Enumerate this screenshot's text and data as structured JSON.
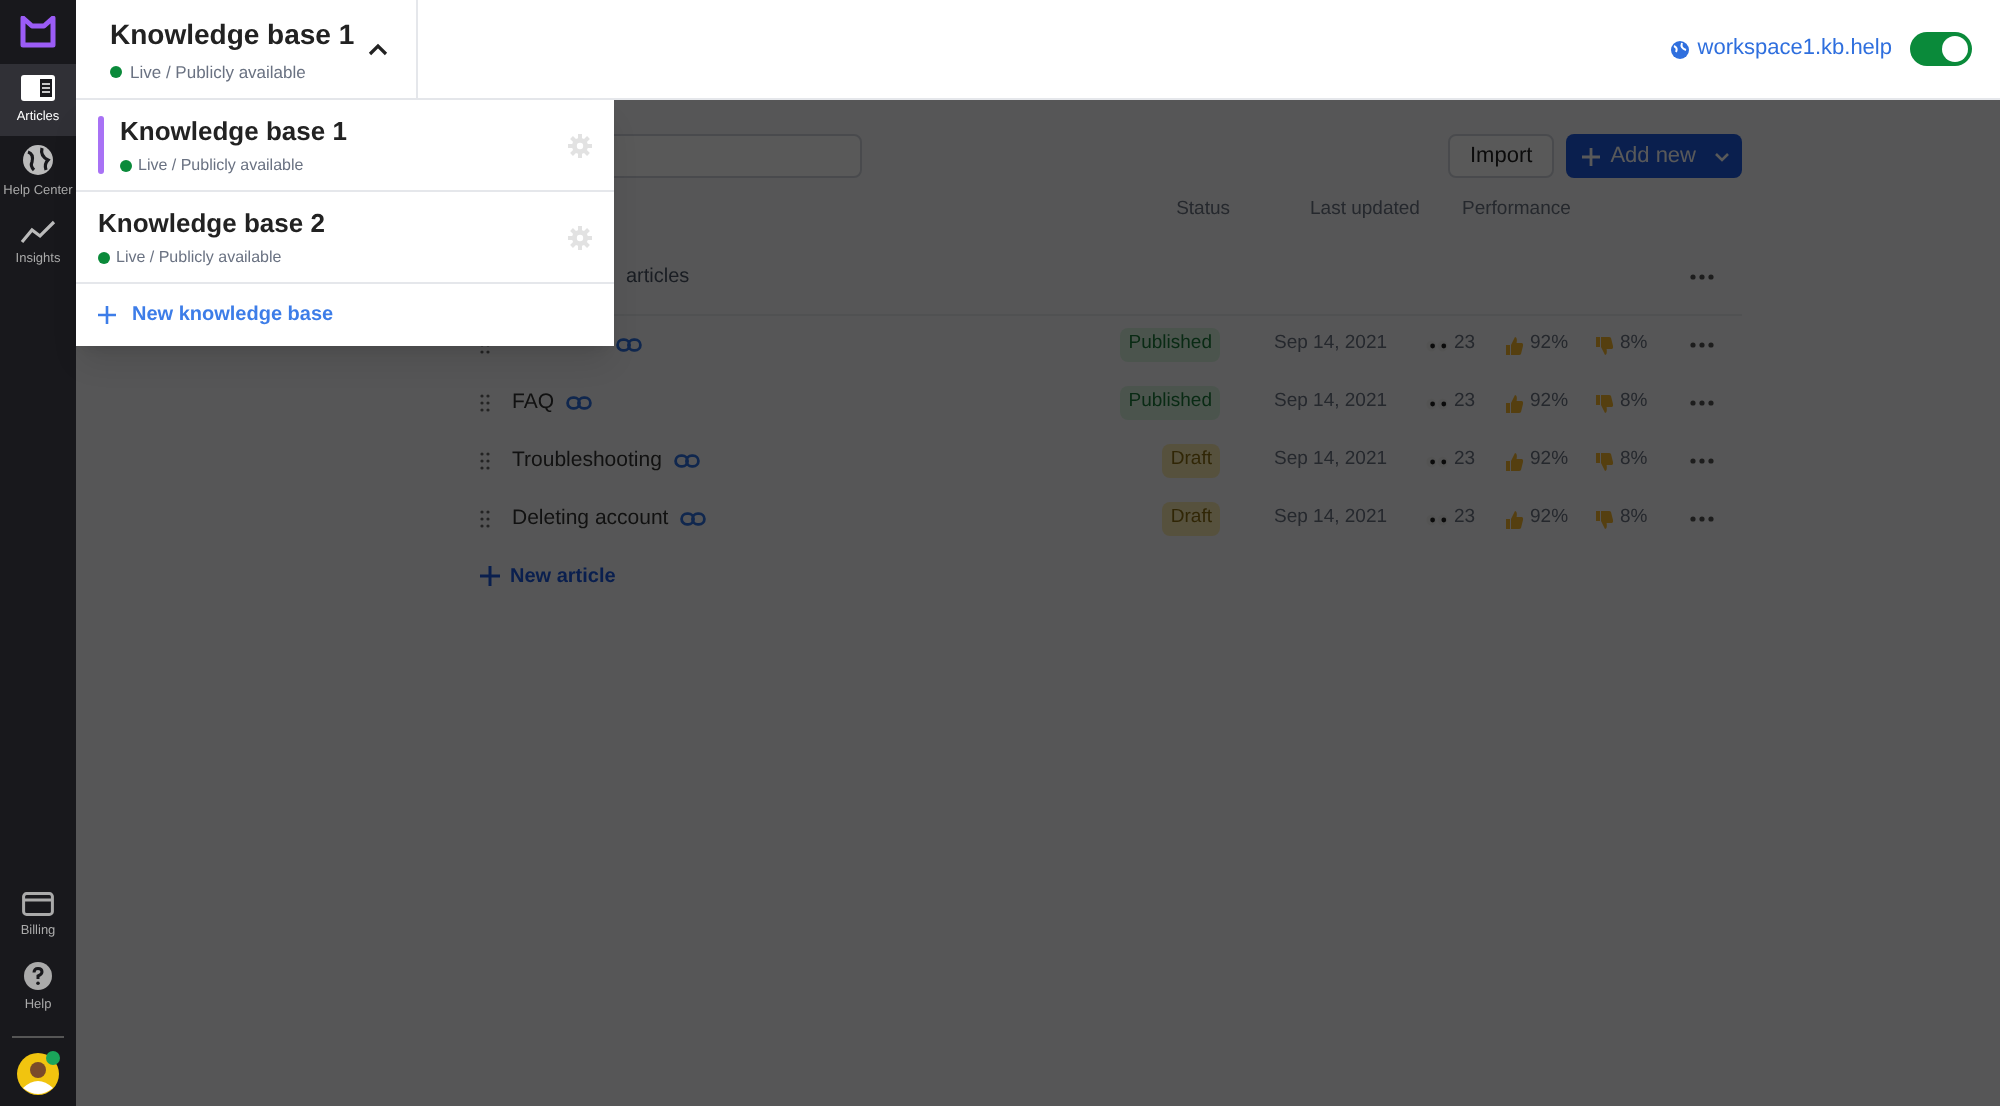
{
  "sidebar": {
    "items": [
      {
        "label": "Articles",
        "selected": true
      },
      {
        "label": "Help Center",
        "selected": false
      },
      {
        "label": "Insights",
        "selected": false
      }
    ],
    "bottom_items": [
      {
        "label": "Billing"
      },
      {
        "label": "Help"
      }
    ]
  },
  "header": {
    "title": "Knowledge base 1",
    "status": "Live / Publicly available",
    "link": "workspace1.kb.help",
    "toggle": {
      "on": true
    }
  },
  "dropdown": {
    "items": [
      {
        "title": "Knowledge base 1",
        "status": "Live / Publicly available",
        "selected": true
      },
      {
        "title": "Knowledge base 2",
        "status": "Live / Publicly available",
        "selected": false
      }
    ],
    "new_button": "New knowledge base"
  },
  "toolbar": {
    "import": "Import",
    "add_new": "Add new"
  },
  "table": {
    "columns": [
      "Status",
      "Last updated",
      "Performance"
    ],
    "group_count": "articles",
    "rows": [
      {
        "status": "Published",
        "kind": "published",
        "updated": "Sep 14, 2021",
        "views": "23",
        "likes": "92%",
        "dislikes": "8%"
      },
      {
        "title": "FAQ",
        "status": "Published",
        "kind": "published",
        "updated": "Sep 14, 2021",
        "views": "23",
        "likes": "92%",
        "dislikes": "8%"
      },
      {
        "title": "Troubleshooting",
        "status": "Draft",
        "kind": "draft",
        "updated": "Sep 14, 2021",
        "views": "23",
        "likes": "92%",
        "dislikes": "8%"
      },
      {
        "title": "Deleting account",
        "status": "Draft",
        "kind": "draft",
        "updated": "Sep 14, 2021",
        "views": "23",
        "likes": "92%",
        "dislikes": "8%"
      }
    ]
  },
  "new_article": "New article"
}
